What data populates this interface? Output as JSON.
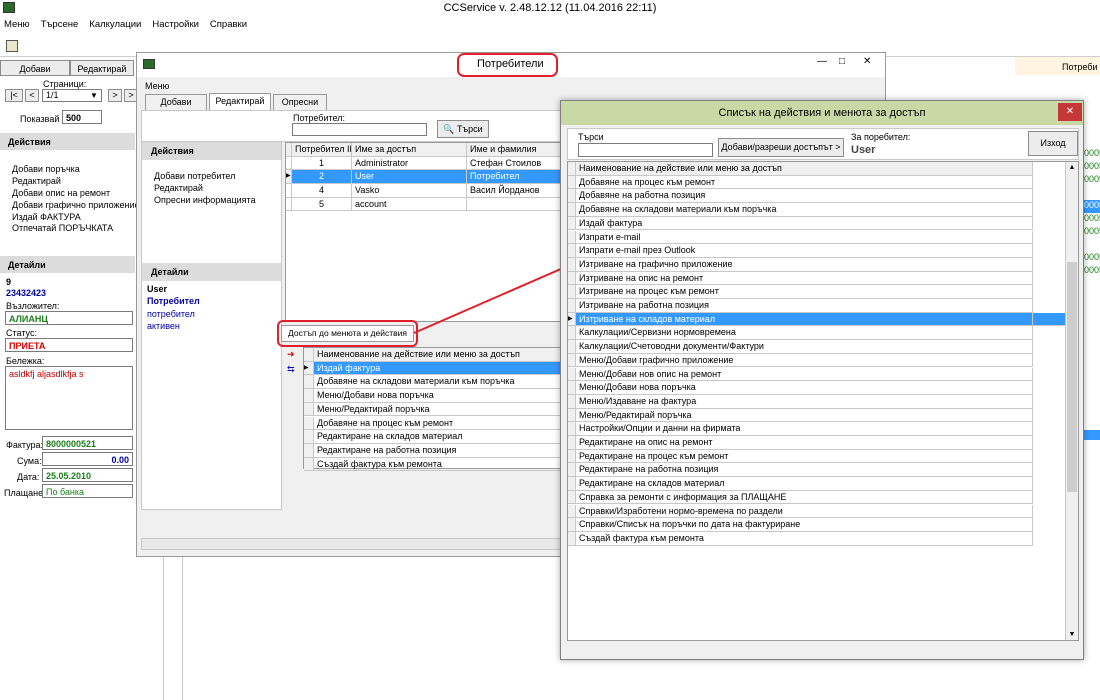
{
  "app": {
    "title": "CCService v. 2.48.12.12 (11.04.2016 22:11)",
    "menu": [
      "Меню",
      "Търсене",
      "Калкулации",
      "Настройки",
      "Справки"
    ]
  },
  "left": {
    "add_label": "Добави",
    "edit_label": "Редактирай",
    "pages_label": "Страници:",
    "page_value": "1/1",
    "show_label": "Показвай",
    "show_value": "500",
    "actions_title": "Действия",
    "actions": [
      "Добави поръчка",
      "Редактирай",
      "Добави опис на ремонт",
      "Добави графично приложение",
      "Издай ФАКТУРА",
      "Отпечатай ПОРЪЧКАТА"
    ],
    "details_title": "Детайли",
    "order_no": "9",
    "order_code": "23432423",
    "assignor_label": "Възложител:",
    "assignor_value": "АЛИАНЦ",
    "status_label": "Статус:",
    "status_value": "ПРИЕТА",
    "note_label": "Бележка:",
    "note_value": "asldkfj aljasdlkfja s",
    "invoice_label": "Фактура:",
    "invoice_value": "8000000521",
    "sum_label": "Сума:",
    "sum_value": "0.00",
    "date_label": "Дата:",
    "date_value": "25.05.2010",
    "payment_label": "Плащане:",
    "payment_value": "По банка"
  },
  "right_edge": {
    "tab_label": "Потреби",
    "codes": [
      "0005",
      "0005",
      "0005",
      "0005",
      "0005",
      "0005",
      "0005",
      "0005"
    ]
  },
  "users_window": {
    "title": "Потребители",
    "menu_label": "Меню",
    "tabs": [
      "Добави",
      "Редактирай",
      "Опресни"
    ],
    "user_label": "Потребител:",
    "search_button": "Търси",
    "actions_title": "Действия",
    "actions": [
      "Добави потребител",
      "Редактирай",
      "Опресни информацията"
    ],
    "details_title": "Детайли",
    "detail_user": "User",
    "detail_role": "Потребител",
    "detail_role_lower": "потребител",
    "detail_status": "активен",
    "grid_headers": [
      "Потребител ID",
      "Име за достъп",
      "Име и фамилия"
    ],
    "grid_rows": [
      {
        "id": "1",
        "login": "Administrator",
        "name": "Стефан Стоилов",
        "selected": false
      },
      {
        "id": "2",
        "login": "User",
        "name": "Потребител",
        "selected": true
      },
      {
        "id": "4",
        "login": "Vasko",
        "name": "Васил Йорданов",
        "selected": false
      },
      {
        "id": "5",
        "login": "account",
        "name": "",
        "selected": false
      }
    ],
    "access_tab": "Достъп до менюта и действия",
    "access_header": "Наименование на действие или меню за достъп",
    "access_rows": [
      {
        "text": "Издай фактура",
        "selected": true
      },
      {
        "text": "Добавяне на складови материали към поръчка",
        "selected": false
      },
      {
        "text": "Меню/Добави нова поръчка",
        "selected": false
      },
      {
        "text": "Меню/Редактирай поръчка",
        "selected": false
      },
      {
        "text": "Добавяне на процес към ремонт",
        "selected": false
      },
      {
        "text": "Редактиране на складов материал",
        "selected": false
      },
      {
        "text": "Редактиране на работна позиция",
        "selected": false
      },
      {
        "text": "Създай фактура към ремонта",
        "selected": false
      }
    ]
  },
  "access_dialog": {
    "title": "Списък на действия и менюта за достъп",
    "close_glyph": "✕",
    "search_label": "Търси",
    "allow_button": "Добави/разреши достъпът >",
    "for_user_label": "За поребител:",
    "for_user_value": "User",
    "exit_button": "Изход",
    "header": "Наименование на действие или меню за достъп",
    "items": [
      {
        "text": "Добавяне на процес към ремонт",
        "selected": false
      },
      {
        "text": "Добавяне на работна позиция",
        "selected": false
      },
      {
        "text": "Добавяне на складови материали към поръчка",
        "selected": false
      },
      {
        "text": "Издай фактура",
        "selected": false
      },
      {
        "text": "Изпрати e-mail",
        "selected": false
      },
      {
        "text": "Изпрати e-mail през Outlook",
        "selected": false
      },
      {
        "text": "Изтриване на графично приложение",
        "selected": false
      },
      {
        "text": "Изтриване на опис на ремонт",
        "selected": false
      },
      {
        "text": "Изтриване на процес към ремонт",
        "selected": false
      },
      {
        "text": "Изтриване на работна позиция",
        "selected": false
      },
      {
        "text": "Изтриване на складов материал",
        "selected": true
      },
      {
        "text": "Калкулации/Сервизни нормовремена",
        "selected": false
      },
      {
        "text": "Калкулации/Счетоводни документи/Фактури",
        "selected": false
      },
      {
        "text": "Меню/Добави графично приложение",
        "selected": false
      },
      {
        "text": "Меню/Добави нов опис на ремонт",
        "selected": false
      },
      {
        "text": "Меню/Добави нова поръчка",
        "selected": false
      },
      {
        "text": "Меню/Издаване на фактура",
        "selected": false
      },
      {
        "text": "Меню/Редактирай поръчка",
        "selected": false
      },
      {
        "text": "Настройки/Опции и данни на фирмата",
        "selected": false
      },
      {
        "text": "Редактиране на опис на ремонт",
        "selected": false
      },
      {
        "text": "Редактиране на процес към ремонт",
        "selected": false
      },
      {
        "text": "Редактиране на работна позиция",
        "selected": false
      },
      {
        "text": "Редактиране на складов материал",
        "selected": false
      },
      {
        "text": "Справка за ремонти с информация за ПЛАЩАНЕ",
        "selected": false
      },
      {
        "text": "Справки/Изработени нормо-времена по раздели",
        "selected": false
      },
      {
        "text": "Справки/Списък на поръчки по дата на фактуриране",
        "selected": false
      },
      {
        "text": "Създай фактура към ремонта",
        "selected": false
      }
    ]
  },
  "colors": {
    "selection": "#3399ff",
    "annotation": "#e0202a",
    "green_value": "#1a7f1a",
    "red_value": "#d40000",
    "navy_text": "#0000a0",
    "note_text": "#c00000"
  }
}
